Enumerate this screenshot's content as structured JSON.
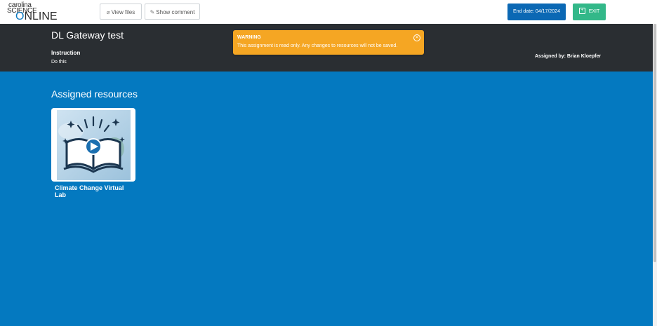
{
  "logo": {
    "line1": "carolina",
    "line2": "SCIENCE",
    "line3_prefix": "",
    "line3_o": "O",
    "line3_rest": "NLINE"
  },
  "toolbar": {
    "view_files_label": "View files",
    "show_comment_label": "Show comment",
    "end_date_label": "End date: 04/17/2024",
    "exit_label": "EXIT"
  },
  "assignment": {
    "title": "DL Gateway test",
    "instruction_label": "Instruction",
    "instruction_text": "Do this",
    "assigned_by": "Assigned by: Brian Kloepfer"
  },
  "warning": {
    "title": "WARNING",
    "message": "This assignment is read only. Any changes to resources will not be saved."
  },
  "resources": {
    "section_title": "Assigned resources",
    "items": [
      {
        "title": "Climate Change Virtual Lab"
      }
    ]
  },
  "colors": {
    "header_bg": "#2a2e32",
    "main_bg": "#0479c0",
    "warning_bg": "#f5a623",
    "end_date_bg": "#0b68b4",
    "exit_bg": "#33b889"
  },
  "icons": {
    "view_files": "paperclip-icon",
    "show_comment": "pencil-icon",
    "exit": "exit-icon",
    "warning_close": "close-circle-icon",
    "thumbnail": "open-book-play-icon"
  }
}
